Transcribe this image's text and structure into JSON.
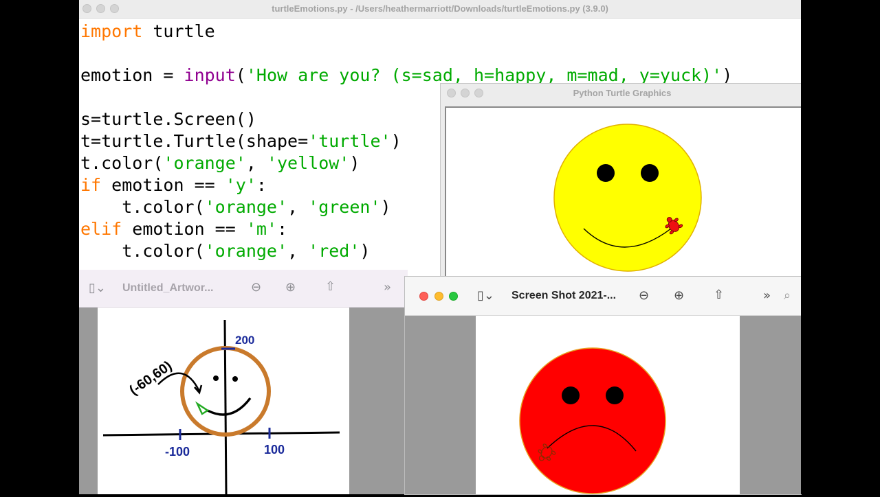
{
  "editor": {
    "title": "turtleEmotions.py - /Users/heathermarriott/Downloads/turtleEmotions.py (3.9.0)",
    "code": [
      [
        {
          "t": "import",
          "c": "kw"
        },
        {
          "t": " turtle",
          "c": ""
        }
      ],
      [],
      [
        {
          "t": "emotion = ",
          "c": ""
        },
        {
          "t": "input",
          "c": "bi"
        },
        {
          "t": "(",
          "c": ""
        },
        {
          "t": "'How are you? (s=sad, h=happy, m=mad, y=yuck)'",
          "c": "st"
        },
        {
          "t": ")",
          "c": ""
        }
      ],
      [],
      [
        {
          "t": "s=turtle.Screen()",
          "c": ""
        }
      ],
      [
        {
          "t": "t=turtle.Turtle(shape=",
          "c": ""
        },
        {
          "t": "'turtle'",
          "c": "st"
        },
        {
          "t": ")",
          "c": ""
        }
      ],
      [
        {
          "t": "t.color(",
          "c": ""
        },
        {
          "t": "'orange'",
          "c": "st"
        },
        {
          "t": ", ",
          "c": ""
        },
        {
          "t": "'yellow'",
          "c": "st"
        },
        {
          "t": ")",
          "c": ""
        }
      ],
      [
        {
          "t": "if",
          "c": "kw"
        },
        {
          "t": " emotion == ",
          "c": ""
        },
        {
          "t": "'y'",
          "c": "st"
        },
        {
          "t": ":",
          "c": ""
        }
      ],
      [
        {
          "t": "    t.color(",
          "c": ""
        },
        {
          "t": "'orange'",
          "c": "st"
        },
        {
          "t": ", ",
          "c": ""
        },
        {
          "t": "'green'",
          "c": "st"
        },
        {
          "t": ")",
          "c": ""
        }
      ],
      [
        {
          "t": "elif",
          "c": "kw"
        },
        {
          "t": " emotion == ",
          "c": ""
        },
        {
          "t": "'m'",
          "c": "st"
        },
        {
          "t": ":",
          "c": ""
        }
      ],
      [
        {
          "t": "    t.color(",
          "c": ""
        },
        {
          "t": "'orange'",
          "c": "st"
        },
        {
          "t": ", ",
          "c": ""
        },
        {
          "t": "'red'",
          "c": "st"
        },
        {
          "t": ")",
          "c": ""
        }
      ]
    ]
  },
  "turtle_window": {
    "title": "Python Turtle Graphics",
    "face_fill": "#ffff00",
    "face_outline": "#e0b000",
    "turtle_color": "#ee1111"
  },
  "preview_left": {
    "title": "Untitled_Artwor...",
    "icons": [
      "sidebar-icon",
      "zoom-out-icon",
      "zoom-in-icon",
      "share-icon",
      "more-icon"
    ],
    "sketch_labels": {
      "top": "200",
      "left": "-100",
      "right": "100",
      "point": "(-60,60)"
    }
  },
  "preview_right": {
    "title": "Screen Shot 2021-...",
    "icons": [
      "sidebar-icon",
      "zoom-out-icon",
      "zoom-in-icon",
      "share-icon",
      "more-icon",
      "search-icon"
    ],
    "face_fill": "#ff0000",
    "face_outline": "#e8a020"
  }
}
